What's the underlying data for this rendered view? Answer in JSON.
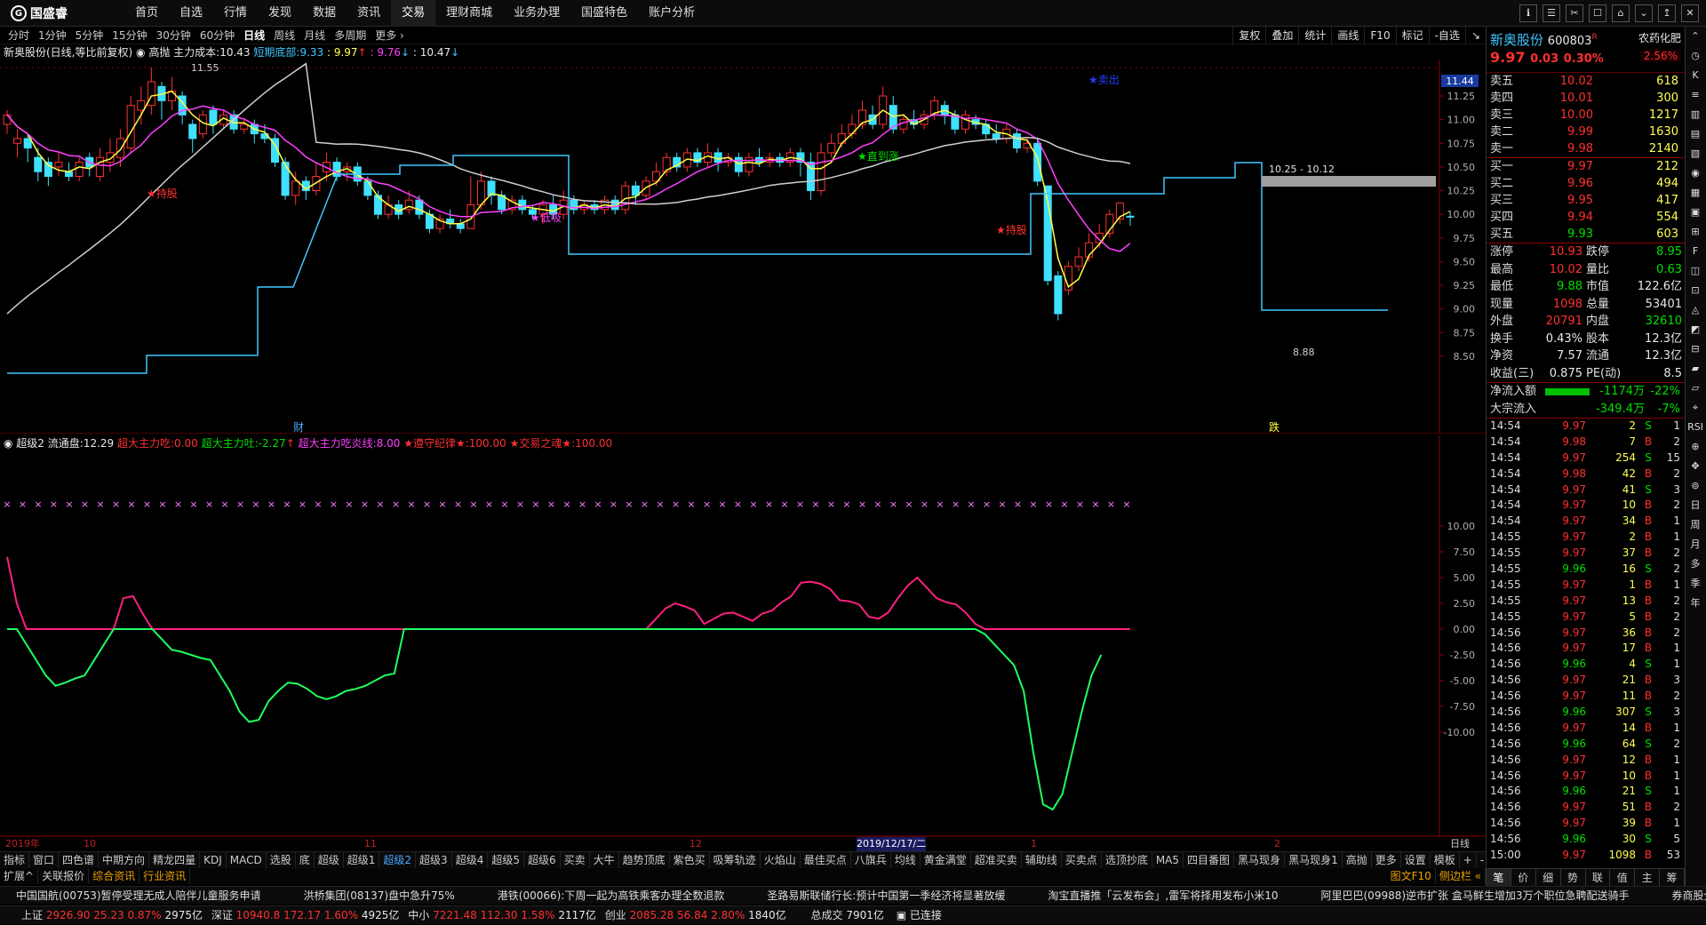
{
  "app": {
    "logo": "国盛睿",
    "menu": [
      "首页",
      "自选",
      "行情",
      "发现",
      "数据",
      "资讯",
      "交易",
      "理财商城",
      "业务办理",
      "国盛特色",
      "账户分析"
    ],
    "active_menu": "交易",
    "window_buttons": [
      "ℹ",
      "☰",
      "✂",
      "☐",
      "⌂",
      "⌄",
      "↥",
      "✕"
    ]
  },
  "periods": [
    "分时",
    "1分钟",
    "5分钟",
    "15分钟",
    "30分钟",
    "60分钟",
    "日线",
    "周线",
    "月线",
    "多周期",
    "更多 ›"
  ],
  "active_period": "日线",
  "toolbar": [
    "复权",
    "叠加",
    "统计",
    "画线",
    "F10",
    "标记",
    "-自选",
    "↘"
  ],
  "info_line": {
    "stock": "新奥股份(日线,等比前复权)",
    "indicator": "高抛",
    "cost_label": "主力成本:",
    "cost_value": "10.43",
    "bottom_label": "短期底部:",
    "bottom_value": "9.33",
    "v1": "9.97",
    "v2": "9.76",
    "v3": "10.47"
  },
  "main_chart": {
    "y_labels": [
      "11.25",
      "11.00",
      "10.75",
      "10.50",
      "10.25",
      "10.00",
      "9.75",
      "9.50",
      "9.25",
      "9.00",
      "8.75",
      "8.50"
    ],
    "price_tag": "11.44",
    "high_label": "11.55",
    "low_label": "8.88",
    "range_label": "10.25 - 10.12",
    "annotations": [
      {
        "text": "★持股",
        "color": "#ff3030"
      },
      {
        "text": "★低吸",
        "color": "#ff40ff"
      },
      {
        "text": "★直到涨",
        "color": "#00e000"
      },
      {
        "text": "★持股",
        "color": "#ff3030"
      },
      {
        "text": "★卖出",
        "color": "#2040ff"
      }
    ],
    "markers": [
      "财",
      "跌"
    ]
  },
  "indicator": {
    "name": "超级2",
    "float_label": "流通盘:",
    "float_value": "12.29",
    "s1_label": "超大主力吃:",
    "s1_value": "0.00",
    "s2_label": "超大主力吐:",
    "s2_value": "-2.27",
    "s3_label": "超大主力吃炎线:",
    "s3_value": "8.00",
    "s4_label": "★遵守纪律★:",
    "s4_value": "100.00",
    "s5_label": "★交易之魂★:",
    "s5_value": "100.00",
    "y_labels": [
      "10.00",
      "7.50",
      "5.00",
      "2.50",
      "0.00",
      "-2.50",
      "-5.00",
      "-7.50",
      "-10.00"
    ]
  },
  "dates": {
    "labels": [
      "2019年",
      "10",
      "11",
      "12",
      "2019/12/17/二",
      "1",
      "2"
    ],
    "right": "日线"
  },
  "tabs1": [
    "指标",
    "窗口",
    "四色谱",
    "中期方向",
    "精龙四量",
    "KDJ",
    "MACD",
    "选股",
    "底",
    "超级",
    "超级1",
    "超级2",
    "超级3",
    "超级4",
    "超级5",
    "超级6",
    "买卖",
    "大牛",
    "趋势顶底",
    "紫色买",
    "吸筹轨迹",
    "火焰山",
    "最佳买点",
    "八旗兵",
    "均线",
    "黄金满堂",
    "超准买卖",
    "辅助线",
    "买卖点",
    "选顶抄底",
    "MA5",
    "四目番图",
    "黑马现身",
    "黑马现身1",
    "高抛",
    "更多",
    "设置"
  ],
  "tabs1_active": "超级2",
  "tabs1_right": [
    "模板",
    "+",
    "-"
  ],
  "tabs2": [
    "扩展^",
    "关联报价",
    "综合资讯",
    "行业资讯"
  ],
  "tabs2_right": [
    "图文F10",
    "侧边栏 «"
  ],
  "news": [
    "中国国航(00753)暂停受理无成人陪伴儿童服务申请",
    "洪桥集团(08137)盘中急升75%",
    "港铁(00066):下周一起为高铁乘客办理全数退款",
    "圣路易斯联储行长:预计中国第一季经济将显著放缓",
    "淘宝直播推「云发布会」,雷军将择用发布小米10",
    "阿里巴巴(09988)逆市扩张 盒马鲜生增加3万个职位急聘配送骑手",
    "券商股全升"
  ],
  "status": {
    "sh_label": "上证",
    "sh": "2926.90",
    "sh_chg": "25.23",
    "sh_pct": "0.87%",
    "sh_amt": "2975亿",
    "sz_label": "深证",
    "sz": "10940.8",
    "sz_chg": "172.17",
    "sz_pct": "1.60%",
    "sz_amt": "4925亿",
    "zx_label": "中小",
    "zx": "7221.48",
    "zx_chg": "112.30",
    "zx_pct": "1.58%",
    "zx_amt": "2117亿",
    "cy_label": "创业",
    "cy": "2085.28",
    "cy_chg": "56.84",
    "cy_pct": "2.80%",
    "cy_amt": "1840亿",
    "total_label": "总成交",
    "total": "7901亿",
    "conn": "已连接"
  },
  "quote": {
    "name": "新奥股份",
    "code": "600803",
    "r": "R",
    "sector": "农药化肥",
    "price": "9.97",
    "chg": "0.03",
    "pct": "0.30%",
    "sector_pct": "2.56%",
    "asks": [
      {
        "l": "卖五",
        "p": "10.02",
        "v": "618"
      },
      {
        "l": "卖四",
        "p": "10.01",
        "v": "300"
      },
      {
        "l": "卖三",
        "p": "10.00",
        "v": "1217"
      },
      {
        "l": "卖二",
        "p": "9.99",
        "v": "1630"
      },
      {
        "l": "卖一",
        "p": "9.98",
        "v": "2140"
      }
    ],
    "bids": [
      {
        "l": "买一",
        "p": "9.97",
        "v": "212"
      },
      {
        "l": "买二",
        "p": "9.96",
        "v": "494"
      },
      {
        "l": "买三",
        "p": "9.95",
        "v": "417"
      },
      {
        "l": "买四",
        "p": "9.94",
        "v": "554"
      },
      {
        "l": "买五",
        "p": "9.93",
        "v": "603"
      }
    ],
    "stats": [
      {
        "a": "涨停",
        "b": "10.93",
        "c": "跌停",
        "d": "8.95",
        "bc": "red",
        "dc": "green"
      },
      {
        "a": "最高",
        "b": "10.02",
        "c": "量比",
        "d": "0.63",
        "bc": "red",
        "dc": "green"
      },
      {
        "a": "最低",
        "b": "9.88",
        "c": "市值",
        "d": "122.6亿",
        "bc": "green",
        "dc": "white"
      },
      {
        "a": "现量",
        "b": "1098",
        "c": "总量",
        "d": "53401",
        "bc": "red",
        "dc": "white"
      },
      {
        "a": "外盘",
        "b": "20791",
        "c": "内盘",
        "d": "32610",
        "bc": "red",
        "dc": "green"
      },
      {
        "a": "换手",
        "b": "0.43%",
        "c": "股本",
        "d": "12.3亿",
        "bc": "white",
        "dc": "white"
      },
      {
        "a": "净资",
        "b": "7.57",
        "c": "流通",
        "d": "12.3亿",
        "bc": "white",
        "dc": "white"
      },
      {
        "a": "收益(三)",
        "b": "0.875",
        "c": "PE(动)",
        "d": "8.5",
        "bc": "white",
        "dc": "white"
      }
    ],
    "flow": [
      {
        "l": "净流入额",
        "v": "-1174万",
        "p": "-22%"
      },
      {
        "l": "大宗流入",
        "v": "-349.4万",
        "p": "-7%"
      }
    ],
    "ticks": [
      {
        "t": "14:54",
        "p": "9.97",
        "v": "2",
        "bs": "S",
        "n": "1"
      },
      {
        "t": "14:54",
        "p": "9.98",
        "v": "7",
        "bs": "B",
        "n": "2"
      },
      {
        "t": "14:54",
        "p": "9.97",
        "v": "254",
        "bs": "S",
        "n": "15"
      },
      {
        "t": "14:54",
        "p": "9.98",
        "v": "42",
        "bs": "B",
        "n": "2"
      },
      {
        "t": "14:54",
        "p": "9.97",
        "v": "41",
        "bs": "S",
        "n": "3"
      },
      {
        "t": "14:54",
        "p": "9.97",
        "v": "10",
        "bs": "B",
        "n": "2"
      },
      {
        "t": "14:54",
        "p": "9.97",
        "v": "34",
        "bs": "B",
        "n": "1"
      },
      {
        "t": "14:55",
        "p": "9.97",
        "v": "2",
        "bs": "B",
        "n": "1"
      },
      {
        "t": "14:55",
        "p": "9.97",
        "v": "37",
        "bs": "B",
        "n": "2"
      },
      {
        "t": "14:55",
        "p": "9.96",
        "v": "16",
        "bs": "S",
        "n": "2"
      },
      {
        "t": "14:55",
        "p": "9.97",
        "v": "1",
        "bs": "B",
        "n": "1"
      },
      {
        "t": "14:55",
        "p": "9.97",
        "v": "13",
        "bs": "B",
        "n": "2"
      },
      {
        "t": "14:55",
        "p": "9.97",
        "v": "5",
        "bs": "B",
        "n": "2"
      },
      {
        "t": "14:56",
        "p": "9.97",
        "v": "36",
        "bs": "B",
        "n": "2"
      },
      {
        "t": "14:56",
        "p": "9.97",
        "v": "17",
        "bs": "B",
        "n": "1"
      },
      {
        "t": "14:56",
        "p": "9.96",
        "v": "4",
        "bs": "S",
        "n": "1"
      },
      {
        "t": "14:56",
        "p": "9.97",
        "v": "21",
        "bs": "B",
        "n": "3"
      },
      {
        "t": "14:56",
        "p": "9.97",
        "v": "11",
        "bs": "B",
        "n": "2"
      },
      {
        "t": "14:56",
        "p": "9.96",
        "v": "307",
        "bs": "S",
        "n": "3"
      },
      {
        "t": "14:56",
        "p": "9.97",
        "v": "14",
        "bs": "B",
        "n": "1"
      },
      {
        "t": "14:56",
        "p": "9.96",
        "v": "64",
        "bs": "S",
        "n": "2"
      },
      {
        "t": "14:56",
        "p": "9.97",
        "v": "12",
        "bs": "B",
        "n": "1"
      },
      {
        "t": "14:56",
        "p": "9.97",
        "v": "10",
        "bs": "B",
        "n": "1"
      },
      {
        "t": "14:56",
        "p": "9.96",
        "v": "21",
        "bs": "S",
        "n": "1"
      },
      {
        "t": "14:56",
        "p": "9.97",
        "v": "51",
        "bs": "B",
        "n": "2"
      },
      {
        "t": "14:56",
        "p": "9.97",
        "v": "39",
        "bs": "B",
        "n": "1"
      },
      {
        "t": "14:56",
        "p": "9.96",
        "v": "30",
        "bs": "S",
        "n": "5"
      },
      {
        "t": "15:00",
        "p": "9.97",
        "v": "1098",
        "bs": "B",
        "n": "53"
      }
    ],
    "bottom_tabs": [
      "笔",
      "价",
      "细",
      "势",
      "联",
      "值",
      "主",
      "筹"
    ]
  },
  "side_icons": [
    "⌃",
    "◷",
    "K",
    "≡",
    "▥",
    "▤",
    "▧",
    "◉",
    "▦",
    "▣",
    "⊞",
    "F",
    "◫",
    "⊡",
    "◬",
    "◩",
    "⊟",
    "▰",
    "▱",
    "⌖",
    "RSI",
    "⊕",
    "✥",
    "⊚",
    "日",
    "周",
    "月",
    "多",
    "季",
    "年"
  ]
}
